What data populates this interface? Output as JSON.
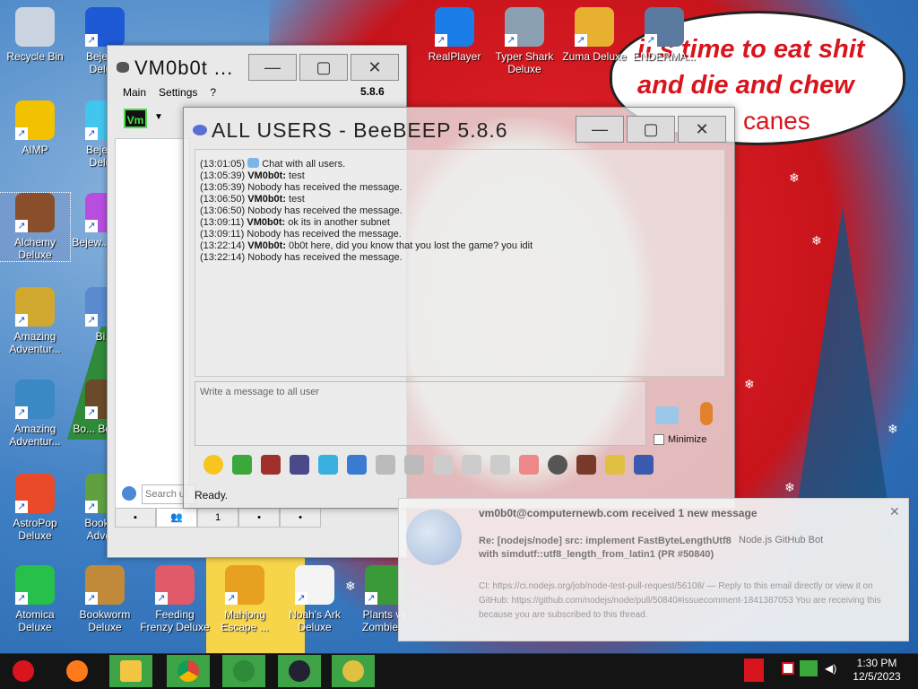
{
  "wallpaper": {
    "bubble_lines": [
      "it's time to eat shit",
      "and die and chew",
      "canes"
    ]
  },
  "desktop_icons": [
    {
      "label": "Recycle Bin",
      "icon": "recycle-bin-icon",
      "color": "#c9d4e0"
    },
    {
      "label": "AIMP",
      "icon": "aimp-icon",
      "color": "#f2c200"
    },
    {
      "label": "Alchemy Deluxe",
      "icon": "alchemy-wizard-icon",
      "color": "#8a4f2a"
    },
    {
      "label": "Amazing Adventur...",
      "icon": "amazing-adventures-icon",
      "color": "#d0a830"
    },
    {
      "label": "Amazing Adventur...",
      "icon": "amazing-adventures-globe-icon",
      "color": "#3a88c4"
    },
    {
      "label": "AstroPop Deluxe",
      "icon": "astropop-icon",
      "color": "#e84a2a"
    },
    {
      "label": "Atomica Deluxe",
      "icon": "atomica-icon",
      "color": "#26c04a"
    },
    {
      "label": "Bejew... Delu...",
      "icon": "bejeweled-icon",
      "color": "#1e5ad6"
    },
    {
      "label": "Bejew... Delu...",
      "icon": "bejeweled-diamond-icon",
      "color": "#42c6ee"
    },
    {
      "label": "Bejew... Twi...",
      "icon": "bejeweled-twist-icon",
      "color": "#b84ee0"
    },
    {
      "label": "Bi...",
      "icon": "game-icon",
      "color": "#5a8ad0"
    },
    {
      "label": "Bo... Books...",
      "icon": "bookworm-icon",
      "color": "#6a4a2a"
    },
    {
      "label": "Bookw... Adver...",
      "icon": "bookworm-adventures-icon",
      "color": "#60a040"
    },
    {
      "label": "Bookworm Deluxe",
      "icon": "bookworm-deluxe-icon",
      "color": "#c08a3a"
    },
    {
      "label": "Feeding Frenzy Deluxe",
      "icon": "feeding-frenzy-icon",
      "color": "#e05a6a"
    },
    {
      "label": "Mahjong Escape ...",
      "icon": "mahjong-icon",
      "color": "#e8a020"
    },
    {
      "label": "Noah's Ark Deluxe",
      "icon": "noahs-ark-icon",
      "color": "#f4f4f4"
    },
    {
      "label": "Plants vs Zombie...",
      "icon": "plants-vs-zombies-icon",
      "color": "#3a9a3a"
    },
    {
      "label": "RealPlayer",
      "icon": "realplayer-icon",
      "color": "#1a7de8"
    },
    {
      "label": "Typer Shark Deluxe",
      "icon": "typer-shark-icon",
      "color": "#8aa0b0"
    },
    {
      "label": "Zuma Deluxe",
      "icon": "zuma-icon",
      "color": "#e8b030"
    },
    {
      "label": "ENDERMA...",
      "icon": "enderman-icon",
      "color": "#5a7aa0"
    }
  ],
  "vm_window": {
    "title": "VM0b0t ...",
    "menu": [
      "Main",
      "Settings",
      "?"
    ],
    "version": "5.8.6",
    "badge": "Vm",
    "search_placeholder": "Search u",
    "tab_count": "1"
  },
  "bee_window": {
    "title": "ALL USERS - BeeBEEP 5.8.6",
    "messages": [
      {
        "time": "(13:01:05)",
        "sender": "",
        "text": "Chat with all users."
      },
      {
        "time": "(13:05:39)",
        "sender": "VM0b0t:",
        "text": "test"
      },
      {
        "time": "(13:05:39)",
        "sender": "",
        "text": "Nobody has received the message."
      },
      {
        "time": "(13:06:50)",
        "sender": "VM0b0t:",
        "text": "test"
      },
      {
        "time": "(13:06:50)",
        "sender": "",
        "text": "Nobody has received the message."
      },
      {
        "time": "(13:09:11)",
        "sender": "VM0b0t:",
        "text": "ok its in another subnet"
      },
      {
        "time": "(13:09:11)",
        "sender": "",
        "text": "Nobody has received the message."
      },
      {
        "time": "(13:22:14)",
        "sender": "VM0b0t:",
        "text": "0b0t here,   did you know that you lost the game? you idit"
      },
      {
        "time": "(13:22:14)",
        "sender": "",
        "text": "Nobody has received the message."
      }
    ],
    "input_placeholder": "Write a message to all user",
    "minimize_label": "Minimize",
    "status": "Ready."
  },
  "notification": {
    "header": "vm0b0t@computernewb.com received 1 new message",
    "subject": "Re: [nodejs/node] src: implement FastByteLengthUtf8 with simdutf::utf8_length_from_latin1 (PR #50840)",
    "from": "Node.js GitHub Bot",
    "body": "CI: https://ci.nodejs.org/job/node-test-pull-request/56108/ — Reply to this email directly or view it on GitHub: https://github.com/nodejs/node/pull/50840#issuecomment-1841387053 You are receiving this because you are subscribed to this thread."
  },
  "taskbar": {
    "time": "1:30 PM",
    "date": "12/5/2023",
    "apps": [
      "santa-start-icon",
      "firefox-icon",
      "file-explorer-icon",
      "chrome-icon",
      "christmas-tree-icon",
      "bonzi-icon",
      "bee-icon"
    ]
  }
}
